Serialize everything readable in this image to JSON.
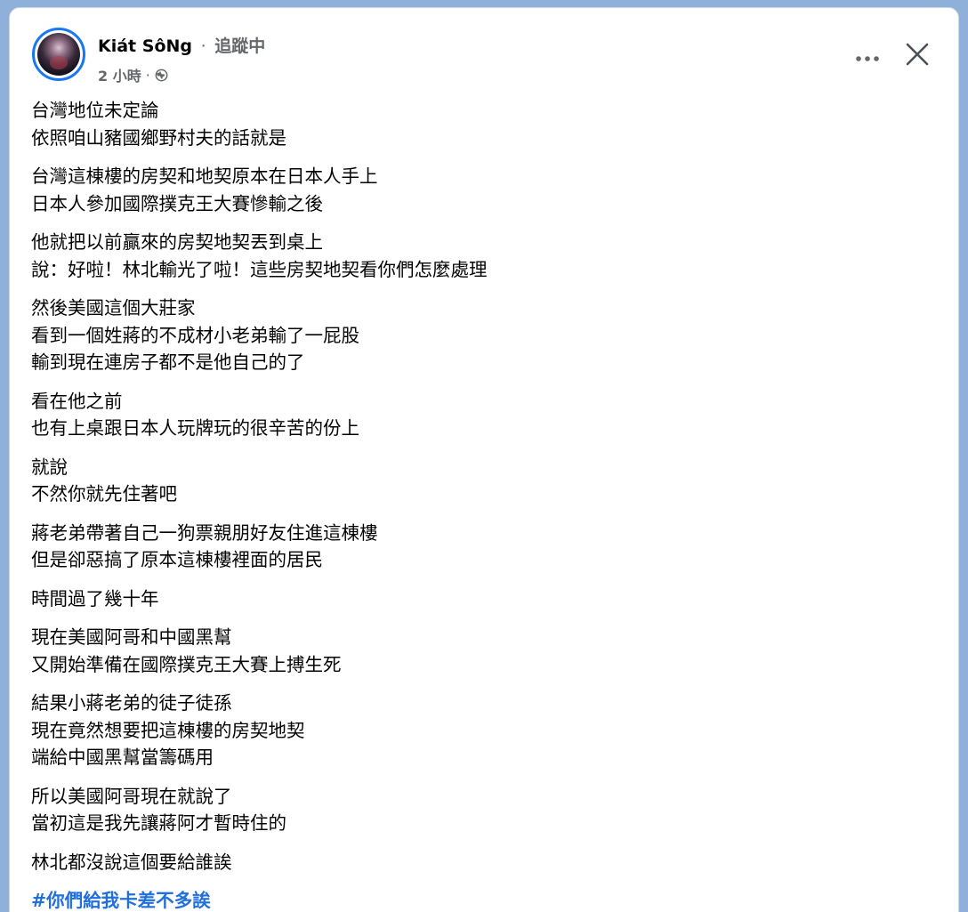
{
  "post": {
    "author": "Kiát SôNg",
    "separator": "·",
    "follow_status": "追蹤中",
    "time": "2 小時",
    "meta_separator": "·",
    "privacy_icon": "globe-icon",
    "more_icon": "more-horizontal-icon",
    "close_icon": "close-icon",
    "paragraphs": [
      {
        "lines": [
          "台灣地位未定論",
          "依照咱山豬國鄉野村夫的話就是"
        ]
      },
      {
        "lines": [
          "台灣這棟樓的房契和地契原本在日本人手上",
          "日本人參加國際撲克王大賽慘輸之後"
        ]
      },
      {
        "lines": [
          "他就把以前贏來的房契地契丟到桌上",
          "說：好啦！林北輸光了啦！這些房契地契看你們怎麼處理"
        ]
      },
      {
        "lines": [
          "然後美國這個大莊家",
          "看到一個姓蔣的不成材小老弟輸了一屁股",
          "輸到現在連房子都不是他自己的了"
        ]
      },
      {
        "lines": [
          "看在他之前",
          "也有上桌跟日本人玩牌玩的很辛苦的份上"
        ]
      },
      {
        "lines": [
          "就說",
          "不然你就先住著吧"
        ]
      },
      {
        "lines": [
          "蔣老弟帶著自己一狗票親朋好友住進這棟樓",
          "但是卻惡搞了原本這棟樓裡面的居民"
        ]
      },
      {
        "lines": [
          "時間過了幾十年"
        ]
      },
      {
        "lines": [
          "現在美國阿哥和中國黑幫",
          "又開始準備在國際撲克王大賽上搏生死"
        ]
      },
      {
        "lines": [
          "結果小蔣老弟的徒子徒孫",
          "現在竟然想要把這棟樓的房契地契",
          "端給中國黑幫當籌碼用"
        ]
      },
      {
        "lines": [
          "所以美國阿哥現在就說了",
          "當初這是我先讓蔣阿才暫時住的"
        ]
      },
      {
        "lines": [
          "林北都沒說這個要給誰誒"
        ]
      }
    ],
    "hashtag": "#你們給我卡差不多誒"
  },
  "colors": {
    "accent": "#1877f2",
    "hashtag": "#216fdb",
    "secondary_text": "#65676b",
    "primary_text": "#050505"
  }
}
